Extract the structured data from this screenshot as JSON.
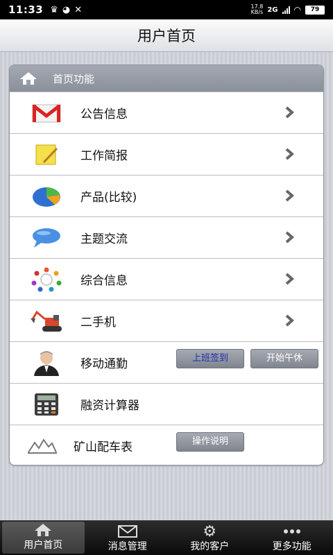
{
  "status_bar": {
    "time": "11:33",
    "speed_value": "17.8",
    "speed_unit": "KB/s",
    "network": "2G",
    "battery": "79"
  },
  "title_bar": {
    "title": "用户首页"
  },
  "section": {
    "title": "首页功能",
    "items": [
      {
        "label": "公告信息",
        "icon": "mail-icon"
      },
      {
        "label": "工作简报",
        "icon": "note-icon"
      },
      {
        "label": "产品(比较)",
        "icon": "pie-chart-icon"
      },
      {
        "label": "主题交流",
        "icon": "chat-bubble-icon"
      },
      {
        "label": "综合信息",
        "icon": "people-circle-icon"
      },
      {
        "label": "二手机",
        "icon": "excavator-icon"
      },
      {
        "label": "移动通勤",
        "icon": "person-avatar-icon",
        "buttons": [
          "上班签到",
          "开始午休"
        ]
      },
      {
        "label": "融资计算器",
        "icon": "calculator-icon"
      },
      {
        "label": "矿山配车表",
        "icon": "mountain-icon",
        "buttons": [
          "操作说明"
        ]
      }
    ]
  },
  "bottom_nav": {
    "items": [
      {
        "label": "用户首页",
        "icon": "home-icon",
        "active": true
      },
      {
        "label": "消息管理",
        "icon": "envelope-icon"
      },
      {
        "label": "我的客户",
        "icon": "gear-icon"
      },
      {
        "label": "更多功能",
        "icon": "more-icon"
      }
    ]
  },
  "colors": {
    "accent_blue": "#1f2fb0",
    "header_gray": "#8a909a"
  }
}
